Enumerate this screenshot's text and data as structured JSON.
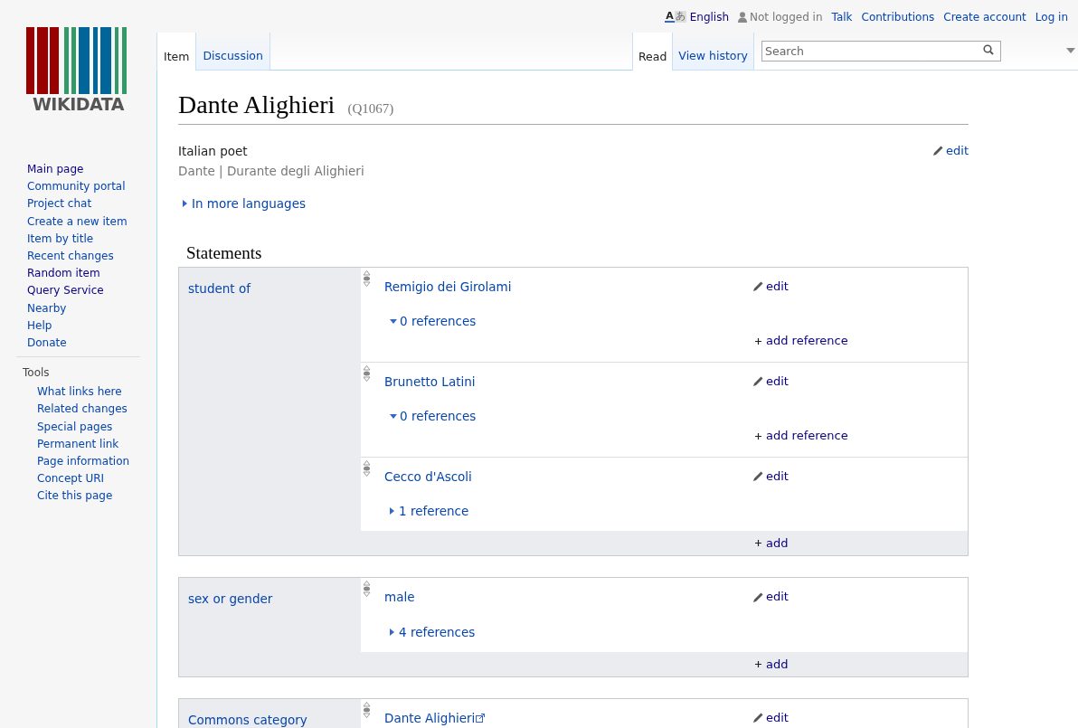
{
  "personal": {
    "language_icon": [
      "A",
      "あ"
    ],
    "language": "English",
    "user_status": "Not logged in",
    "links": [
      "Talk",
      "Contributions",
      "Create account",
      "Log in"
    ]
  },
  "logo": {
    "wordmark": "WIKIDATA"
  },
  "left_tabs": [
    {
      "label": "Item",
      "selected": true
    },
    {
      "label": "Discussion",
      "selected": false
    }
  ],
  "right_tabs": [
    {
      "label": "Read",
      "selected": true
    },
    {
      "label": "View history",
      "selected": false
    }
  ],
  "search": {
    "placeholder": "Search"
  },
  "sidebar": {
    "items": [
      {
        "label": "Main page",
        "visited": true
      },
      {
        "label": "Community portal",
        "visited": false
      },
      {
        "label": "Project chat",
        "visited": false
      },
      {
        "label": "Create a new item",
        "visited": false
      },
      {
        "label": "Item by title",
        "visited": false
      },
      {
        "label": "Recent changes",
        "visited": false
      },
      {
        "label": "Random item",
        "visited": true
      },
      {
        "label": "Query Service",
        "visited": true
      },
      {
        "label": "Nearby",
        "visited": false
      },
      {
        "label": "Help",
        "visited": false
      },
      {
        "label": "Donate",
        "visited": false
      }
    ],
    "tools_heading": "Tools",
    "tools": [
      "What links here",
      "Related changes",
      "Special pages",
      "Permanent link",
      "Page information",
      "Concept URI",
      "Cite this page"
    ]
  },
  "title": "Dante Alighieri",
  "qid": "(Q1067)",
  "description": "Italian poet",
  "aliases": "Dante | Durante degli Alighieri",
  "header_edit": "edit",
  "more_languages": "In more languages",
  "statements_heading": "Statements",
  "groups": [
    {
      "property": "student of",
      "add": "add",
      "values": [
        {
          "value": "Remigio dei Girolami",
          "external": false,
          "edit": "edit",
          "references": "0 references",
          "expanded": true,
          "add_reference": "add reference"
        },
        {
          "value": "Brunetto Latini",
          "external": false,
          "edit": "edit",
          "references": "0 references",
          "expanded": true,
          "add_reference": "add reference"
        },
        {
          "value": "Cecco d'Ascoli",
          "external": false,
          "edit": "edit",
          "references": "1 reference",
          "expanded": false
        }
      ]
    },
    {
      "property": "sex or gender",
      "add": "add",
      "values": [
        {
          "value": "male",
          "external": false,
          "edit": "edit",
          "references": "4 references",
          "expanded": false
        }
      ]
    },
    {
      "property": "Commons category",
      "values": [
        {
          "value": "Dante Alighieri",
          "external": true,
          "edit": "edit"
        }
      ]
    }
  ]
}
